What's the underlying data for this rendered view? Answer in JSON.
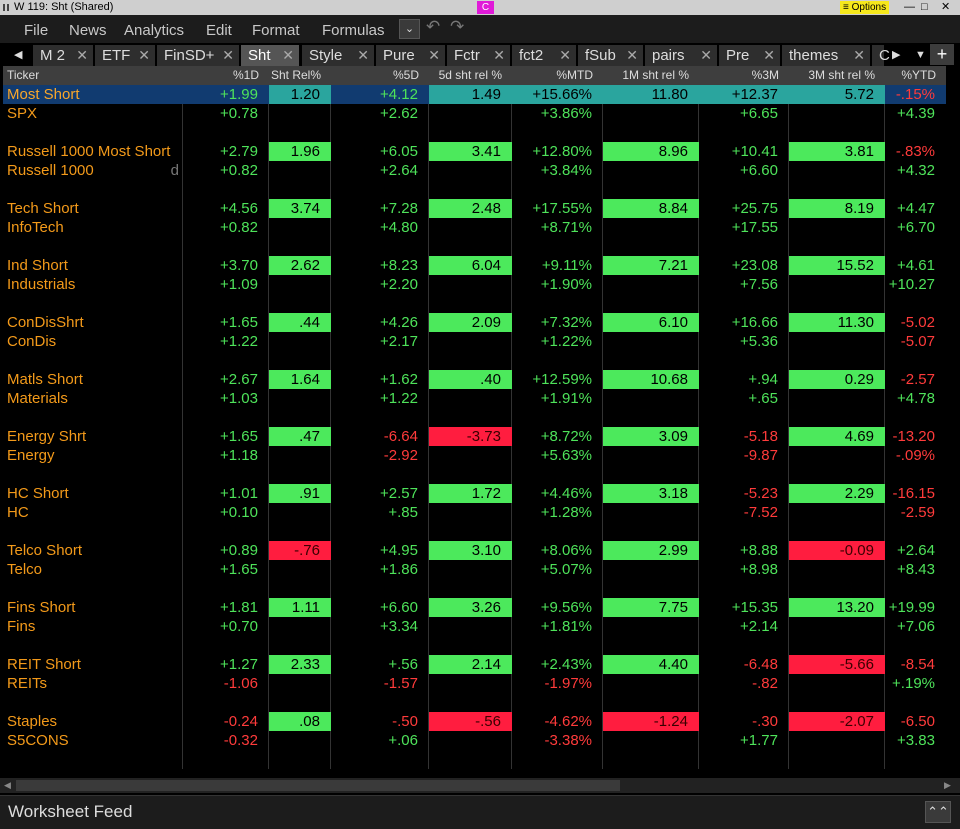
{
  "window": {
    "title": "W 119: Sht (Shared)",
    "badge": "C",
    "options_label": "≡ Options"
  },
  "menu": [
    "File",
    "News",
    "Analytics",
    "Edit",
    "Format",
    "Formulas"
  ],
  "tabs": [
    {
      "label": "M 2",
      "close": "✕"
    },
    {
      "label": "ETF",
      "close": "✕"
    },
    {
      "label": "FinSD+",
      "close": "✕"
    },
    {
      "label": "Sht",
      "close": "✕"
    },
    {
      "label": "Style",
      "close": "✕"
    },
    {
      "label": "Pure",
      "close": "✕"
    },
    {
      "label": "Fctr",
      "close": "✕"
    },
    {
      "label": "fct2",
      "close": "✕"
    },
    {
      "label": "fSub",
      "close": "✕"
    },
    {
      "label": "pairs",
      "close": "✕"
    },
    {
      "label": "Pre",
      "close": "✕"
    },
    {
      "label": "themes",
      "close": "✕"
    },
    {
      "label": "C",
      "close": ""
    }
  ],
  "active_tab": "Sht",
  "columns": [
    "Ticker",
    "%1D",
    "Sht Rel%",
    "%5D",
    "5d sht rel %",
    "%MTD",
    "1M sht rel %",
    "%3M",
    "3M sht rel %",
    "%YTD"
  ],
  "rows": [
    {
      "selected": true,
      "ticker": "Most Short",
      "c": [
        "+1.99",
        "1.20",
        "+4.12",
        "1.49",
        "+15.66%",
        "11.80",
        "+12.37",
        "5.72",
        "-.15%"
      ],
      "bg": [
        null,
        "teal",
        null,
        "teal",
        "teal",
        "teal",
        "teal",
        "teal",
        null
      ]
    },
    {
      "ticker": "SPX",
      "c": [
        "+0.78",
        "",
        "+2.62",
        "",
        "+3.86%",
        "",
        "+6.65",
        "",
        "+4.39"
      ]
    },
    {
      "blank": true
    },
    {
      "ticker": "Russell 1000 Most Short",
      "c": [
        "+2.79",
        "1.96",
        "+6.05",
        "3.41",
        "+12.80%",
        "8.96",
        "+10.41",
        "3.81",
        "-.83%"
      ],
      "bg": [
        null,
        "g",
        null,
        "g",
        null,
        "g",
        null,
        "g",
        null
      ]
    },
    {
      "ticker": "Russell 1000",
      "mark": "d",
      "c": [
        "+0.82",
        "",
        "+2.64",
        "",
        "+3.84%",
        "",
        "+6.60",
        "",
        "+4.32"
      ]
    },
    {
      "blank": true
    },
    {
      "ticker": "Tech Short",
      "c": [
        "+4.56",
        "3.74",
        "+7.28",
        "2.48",
        "+17.55%",
        "8.84",
        "+25.75",
        "8.19",
        "+4.47"
      ],
      "bg": [
        null,
        "g",
        null,
        "g",
        null,
        "g",
        null,
        "g",
        null
      ]
    },
    {
      "ticker": "InfoTech",
      "c": [
        "+0.82",
        "",
        "+4.80",
        "",
        "+8.71%",
        "",
        "+17.55",
        "",
        "+6.70"
      ]
    },
    {
      "blank": true
    },
    {
      "ticker": "Ind Short",
      "c": [
        "+3.70",
        "2.62",
        "+8.23",
        "6.04",
        "+9.11%",
        "7.21",
        "+23.08",
        "15.52",
        "+4.61"
      ],
      "bg": [
        null,
        "g",
        null,
        "g",
        null,
        "g",
        null,
        "g",
        null
      ]
    },
    {
      "ticker": "Industrials",
      "c": [
        "+1.09",
        "",
        "+2.20",
        "",
        "+1.90%",
        "",
        "+7.56",
        "",
        "+10.27"
      ]
    },
    {
      "blank": true
    },
    {
      "ticker": "ConDisShrt",
      "c": [
        "+1.65",
        ".44",
        "+4.26",
        "2.09",
        "+7.32%",
        "6.10",
        "+16.66",
        "11.30",
        "-5.02"
      ],
      "bg": [
        null,
        "g",
        null,
        "g",
        null,
        "g",
        null,
        "g",
        null
      ]
    },
    {
      "ticker": "ConDis",
      "c": [
        "+1.22",
        "",
        "+2.17",
        "",
        "+1.22%",
        "",
        "+5.36",
        "",
        "-5.07"
      ]
    },
    {
      "blank": true
    },
    {
      "ticker": "Matls Short",
      "c": [
        "+2.67",
        "1.64",
        "+1.62",
        ".40",
        "+12.59%",
        "10.68",
        "+.94",
        "0.29",
        "-2.57"
      ],
      "bg": [
        null,
        "g",
        null,
        "g",
        null,
        "g",
        null,
        "g",
        null
      ]
    },
    {
      "ticker": "Materials",
      "c": [
        "+1.03",
        "",
        "+1.22",
        "",
        "+1.91%",
        "",
        "+.65",
        "",
        "+4.78"
      ]
    },
    {
      "blank": true
    },
    {
      "ticker": "Energy Shrt",
      "c": [
        "+1.65",
        ".47",
        "-6.64",
        "-3.73",
        "+8.72%",
        "3.09",
        "-5.18",
        "4.69",
        "-13.20"
      ],
      "bg": [
        null,
        "g",
        null,
        "r",
        null,
        "g",
        null,
        "g",
        null
      ]
    },
    {
      "ticker": "Energy",
      "c": [
        "+1.18",
        "",
        "-2.92",
        "",
        "+5.63%",
        "",
        "-9.87",
        "",
        "-.09%"
      ]
    },
    {
      "blank": true
    },
    {
      "ticker": "HC Short",
      "c": [
        "+1.01",
        ".91",
        "+2.57",
        "1.72",
        "+4.46%",
        "3.18",
        "-5.23",
        "2.29",
        "-16.15"
      ],
      "bg": [
        null,
        "g",
        null,
        "g",
        null,
        "g",
        null,
        "g",
        null
      ]
    },
    {
      "ticker": "HC",
      "c": [
        "+0.10",
        "",
        "+.85",
        "",
        "+1.28%",
        "",
        "-7.52",
        "",
        "-2.59"
      ]
    },
    {
      "blank": true
    },
    {
      "ticker": "Telco Short",
      "c": [
        "+0.89",
        "-.76",
        "+4.95",
        "3.10",
        "+8.06%",
        "2.99",
        "+8.88",
        "-0.09",
        "+2.64"
      ],
      "bg": [
        null,
        "r",
        null,
        "g",
        null,
        "g",
        null,
        "r",
        null
      ]
    },
    {
      "ticker": "Telco",
      "c": [
        "+1.65",
        "",
        "+1.86",
        "",
        "+5.07%",
        "",
        "+8.98",
        "",
        "+8.43"
      ]
    },
    {
      "blank": true
    },
    {
      "ticker": "Fins Short",
      "c": [
        "+1.81",
        "1.11",
        "+6.60",
        "3.26",
        "+9.56%",
        "7.75",
        "+15.35",
        "13.20",
        "+19.99"
      ],
      "bg": [
        null,
        "g",
        null,
        "g",
        null,
        "g",
        null,
        "g",
        null
      ]
    },
    {
      "ticker": "Fins",
      "c": [
        "+0.70",
        "",
        "+3.34",
        "",
        "+1.81%",
        "",
        "+2.14",
        "",
        "+7.06"
      ]
    },
    {
      "blank": true
    },
    {
      "ticker": "REIT Short",
      "c": [
        "+1.27",
        "2.33",
        "+.56",
        "2.14",
        "+2.43%",
        "4.40",
        "-6.48",
        "-5.66",
        "-8.54"
      ],
      "bg": [
        null,
        "g",
        null,
        "g",
        null,
        "g",
        null,
        "r",
        null
      ]
    },
    {
      "ticker": "REITs",
      "c": [
        "-1.06",
        "",
        "-1.57",
        "",
        "-1.97%",
        "",
        "-.82",
        "",
        "+.19%"
      ]
    },
    {
      "blank": true
    },
    {
      "ticker": "Staples",
      "c": [
        "-0.24",
        ".08",
        "-.50",
        "-.56",
        "-4.62%",
        "-1.24",
        "-.30",
        "-2.07",
        "-6.50"
      ],
      "bg": [
        null,
        "g",
        null,
        "r",
        null,
        "r",
        null,
        "r",
        null
      ]
    },
    {
      "ticker": "S5CONS",
      "c": [
        "-0.32",
        "",
        "+.06",
        "",
        "-3.38%",
        "",
        "+1.77",
        "",
        "+3.83"
      ]
    },
    {
      "blank": true
    }
  ],
  "footer": {
    "label": "Worksheet Feed"
  },
  "colors": {
    "up": "#4ee35a",
    "down": "#ff3b3b",
    "cell_green": "#4ce95c",
    "cell_red": "#ff1d3f",
    "cell_teal": "#2aa59e",
    "ticker": "#f39a1a"
  }
}
